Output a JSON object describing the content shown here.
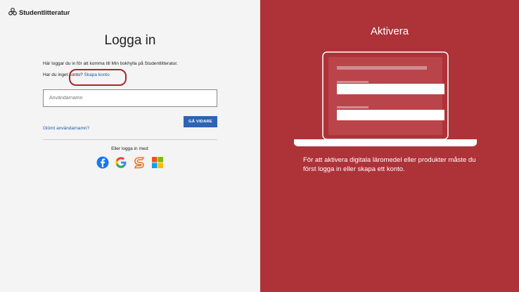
{
  "logo": {
    "text": "Studentlitteratur",
    "icon": "studentlitteratur-logo-icon"
  },
  "login": {
    "title": "Logga in",
    "intro": "Här loggar du in för att komma till Min bokhylla på Studentlitteratur.",
    "no_account_prefix": "Har du inget konto?",
    "create_account_link": "Skapa konto",
    "username_placeholder": "Användarnamn",
    "username_value": "",
    "continue_button": "GÅ VIDARE",
    "forgot_link": "Glömt användarnamn?",
    "other_login": "Eller logga in med:",
    "providers": [
      "facebook-icon",
      "google-icon",
      "studentlitteratur-s-icon",
      "microsoft-icon"
    ]
  },
  "activate": {
    "title": "Aktivera",
    "description": "För att aktivera digitala läromedel eller produkter måste du först logga in eller skapa ett konto."
  },
  "colors": {
    "right_panel": "#ad3339",
    "left_panel": "#f4f4f4",
    "button": "#2d64b3",
    "link": "#1a5aa8",
    "highlight": "#a52830"
  }
}
